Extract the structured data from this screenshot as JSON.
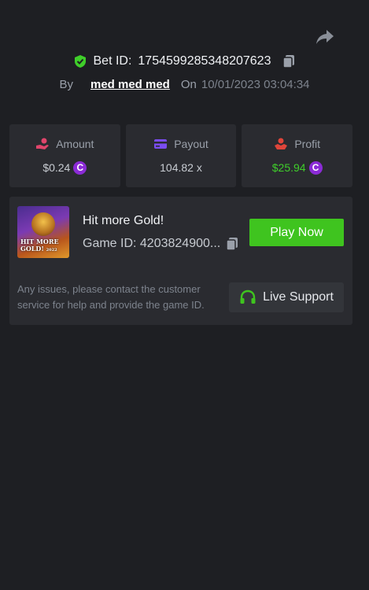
{
  "bet": {
    "label": "Bet ID:",
    "id": "1754599285348207623",
    "by_label": "By",
    "user": "med med med",
    "on_label": "On",
    "datetime": "10/01/2023 03:04:34"
  },
  "stats": [
    {
      "label": "Amount",
      "value": "$0.24",
      "icon": "hand-coins-icon",
      "has_coin": true
    },
    {
      "label": "Payout",
      "value": "104.82 x",
      "icon": "card-icon",
      "has_coin": false
    },
    {
      "label": "Profit",
      "value": "$25.94",
      "icon": "hand-money-icon",
      "has_coin": true
    }
  ],
  "game": {
    "thumbnail_text": "HIT MORE GOLD!",
    "thumbnail_subtext": "2022",
    "title": "Hit more Gold!",
    "id_text": "Game ID: 4203824900...",
    "play_label": "Play Now"
  },
  "support": {
    "help_text": "Any issues, please contact the customer service for help and provide the game ID.",
    "button_label": "Live Support"
  },
  "colors": {
    "background": "#1e1f23",
    "panel": "#2a2b30",
    "accent_green": "#3fc41f",
    "profit_green": "#3fce2a",
    "coin_purple": "#8b2bd6",
    "amount_icon": "#e0456b",
    "payout_icon": "#7a4cf0",
    "profit_icon": "#e0453a"
  },
  "coin_symbol": "C"
}
